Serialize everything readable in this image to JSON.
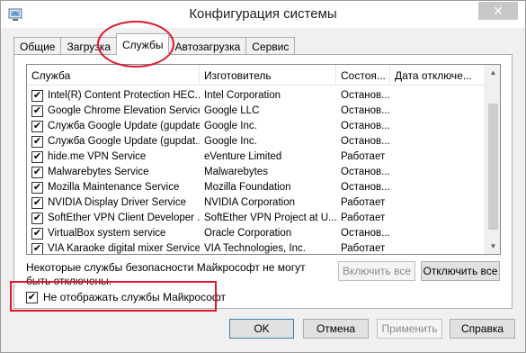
{
  "window": {
    "title": "Конфигурация системы",
    "close_glyph": "✕"
  },
  "icons": {
    "app": "msconfig-icon",
    "close": "close-icon",
    "scroll_up": "scroll-up-arrow",
    "scroll_down": "scroll-down-arrow"
  },
  "tabs": [
    {
      "label": "Общие",
      "active": false
    },
    {
      "label": "Загрузка",
      "active": false
    },
    {
      "label": "Службы",
      "active": true
    },
    {
      "label": "Автозагрузка",
      "active": false
    },
    {
      "label": "Сервис",
      "active": false
    }
  ],
  "services": {
    "columns": [
      "Служба",
      "Изготовитель",
      "Состоя...",
      "Дата отключе..."
    ],
    "rows": [
      {
        "name": "Intel(R) Content Protection HEC...",
        "maker": "Intel Corporation",
        "status": "Останов...",
        "checked": true
      },
      {
        "name": "Google Chrome Elevation Service",
        "maker": "Google LLC",
        "status": "Останов...",
        "checked": true
      },
      {
        "name": "Служба Google Update (gupdate)",
        "maker": "Google Inc.",
        "status": "Останов...",
        "checked": true
      },
      {
        "name": "Служба Google Update (gupdat...",
        "maker": "Google Inc.",
        "status": "Останов...",
        "checked": true
      },
      {
        "name": "hide.me VPN Service",
        "maker": "eVenture Limited",
        "status": "Работает",
        "checked": true
      },
      {
        "name": "Malwarebytes Service",
        "maker": "Malwarebytes",
        "status": "Останов...",
        "checked": true
      },
      {
        "name": "Mozilla Maintenance Service",
        "maker": "Mozilla Foundation",
        "status": "Останов...",
        "checked": true
      },
      {
        "name": "NVIDIA Display Driver Service",
        "maker": "NVIDIA Corporation",
        "status": "Работает",
        "checked": true
      },
      {
        "name": "SoftEther VPN Client Developer ...",
        "maker": "SoftEther VPN Project at U...",
        "status": "Работает",
        "checked": true
      },
      {
        "name": "VirtualBox system service",
        "maker": "Oracle Corporation",
        "status": "Останов...",
        "checked": true
      },
      {
        "name": "VIA Karaoke digital mixer Service",
        "maker": "VIA Technologies, Inc.",
        "status": "Работает",
        "checked": true
      }
    ]
  },
  "note_text": "Некоторые службы безопасности Майкрософт не могут быть отключены.",
  "buttons": {
    "enable_all": "Включить все",
    "disable_all": "Отключить все",
    "ok": "OK",
    "cancel": "Отмена",
    "apply": "Применить",
    "help": "Справка"
  },
  "hide_ms": {
    "label": "Не отображать службы Майкрософт",
    "checked": true
  },
  "colors": {
    "annotation": "#e0182a",
    "window_bg": "#f0f0f0"
  }
}
